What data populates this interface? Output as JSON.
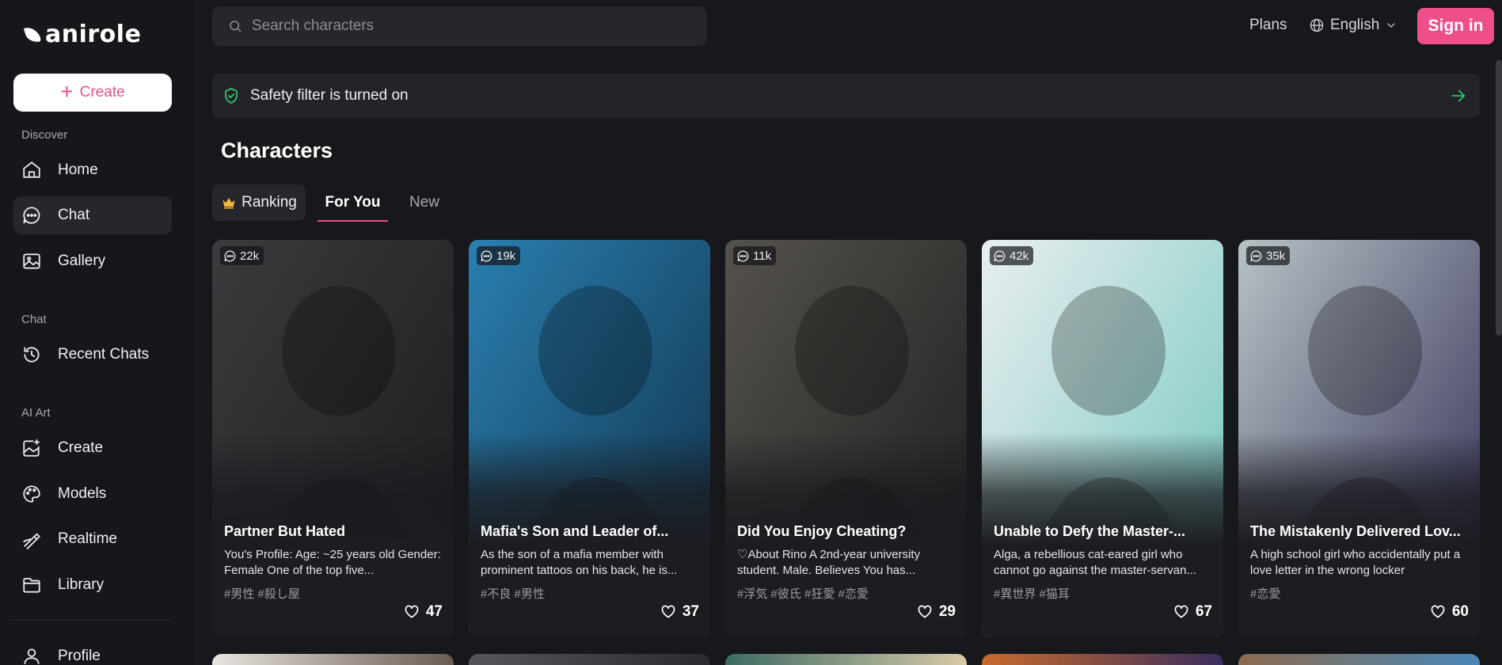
{
  "brand": {
    "name": "anirole"
  },
  "sidebar": {
    "create_label": "Create",
    "sections": {
      "discover": "Discover",
      "chat": "Chat",
      "ai_art": "AI Art"
    },
    "items": {
      "home": "Home",
      "chat": "Chat",
      "gallery": "Gallery",
      "recent_chats": "Recent Chats",
      "art_create": "Create",
      "models": "Models",
      "realtime": "Realtime",
      "library": "Library",
      "profile": "Profile"
    }
  },
  "topbar": {
    "search_placeholder": "Search characters",
    "plans": "Plans",
    "language": "English",
    "sign_in": "Sign in"
  },
  "safety": {
    "text": "Safety filter is turned on"
  },
  "main": {
    "heading": "Characters",
    "tabs": {
      "ranking": "Ranking",
      "for_you": "For You",
      "new": "New"
    },
    "active_tab": "For You"
  },
  "cards": [
    {
      "count": "22k",
      "title": "Partner But Hated",
      "desc": "You's Profile: Age: ~25 years old Gender: Female One of the top five...",
      "tags": "#男性 #殺し屋",
      "likes": "47",
      "palette": [
        "#3b3b3e",
        "#1a1a1c"
      ]
    },
    {
      "count": "19k",
      "title": "Mafia's Son and Leader of...",
      "desc": "As the son of a mafia member with prominent tattoos on his back, he is...",
      "tags": "#不良 #男性",
      "likes": "37",
      "palette": [
        "#2a7fb0",
        "#0f2f47"
      ]
    },
    {
      "count": "11k",
      "title": "Did You Enjoy Cheating?",
      "desc": "♡About Rino A 2nd-year university student. Male. Believes You has...",
      "tags": "#浮気 #彼氏 #狂愛 #恋愛",
      "likes": "29",
      "palette": [
        "#55524c",
        "#1c1c1d"
      ]
    },
    {
      "count": "42k",
      "title": "Unable to Defy the Master-...",
      "desc": "Alga, a rebellious cat-eared girl who cannot go against the master-servan...",
      "tags": "#異世界 #猫耳",
      "likes": "67",
      "palette": [
        "#e9eef0",
        "#6fc5bb"
      ]
    },
    {
      "count": "35k",
      "title": "The Mistakenly Delivered Lov...",
      "desc": "A high school girl who accidentally put a love letter in the wrong locker",
      "tags": "#恋愛",
      "likes": "60",
      "palette": [
        "#b7c2c4",
        "#2e2a55"
      ]
    }
  ],
  "colors": {
    "accent": "#ee4f8b",
    "safety_green": "#2fc46b",
    "background": "#17181c"
  }
}
